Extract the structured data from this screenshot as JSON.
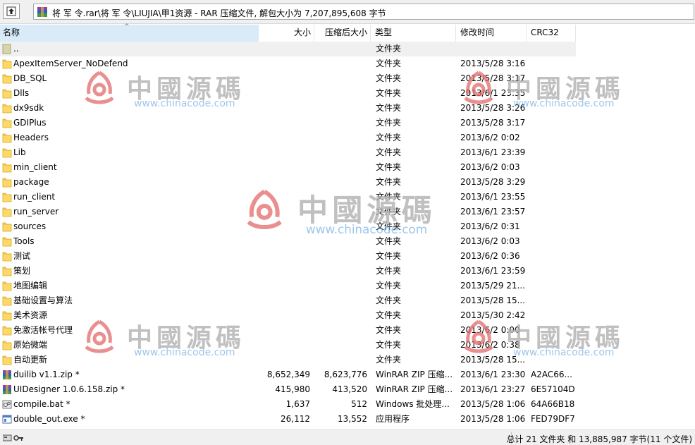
{
  "toolbar": {
    "path": "将 军 令.rar\\将 军 令\\LIUJIA\\甲1资源 - RAR 压缩文件, 解包大小为 7,207,895,608 字节"
  },
  "columns": {
    "name": "名称",
    "size": "大小",
    "packed": "压缩后大小",
    "type": "类型",
    "modified": "修改时间",
    "crc": "CRC32"
  },
  "rows": [
    {
      "name": "..",
      "size": "",
      "packed": "",
      "type": "文件夹",
      "modified": "",
      "crc": "",
      "icon": "parent-folder"
    },
    {
      "name": "ApexItemServer_NoDefend",
      "size": "",
      "packed": "",
      "type": "文件夹",
      "modified": "2013/5/28 3:16",
      "crc": "",
      "icon": "folder"
    },
    {
      "name": "DB_SQL",
      "size": "",
      "packed": "",
      "type": "文件夹",
      "modified": "2013/5/28 3:17",
      "crc": "",
      "icon": "folder"
    },
    {
      "name": "Dlls",
      "size": "",
      "packed": "",
      "type": "文件夹",
      "modified": "2013/6/1 23:35",
      "crc": "",
      "icon": "folder"
    },
    {
      "name": "dx9sdk",
      "size": "",
      "packed": "",
      "type": "文件夹",
      "modified": "2013/5/28 3:26",
      "crc": "",
      "icon": "folder"
    },
    {
      "name": "GDIPlus",
      "size": "",
      "packed": "",
      "type": "文件夹",
      "modified": "2013/5/28 3:17",
      "crc": "",
      "icon": "folder"
    },
    {
      "name": "Headers",
      "size": "",
      "packed": "",
      "type": "文件夹",
      "modified": "2013/6/2 0:02",
      "crc": "",
      "icon": "folder"
    },
    {
      "name": "Lib",
      "size": "",
      "packed": "",
      "type": "文件夹",
      "modified": "2013/6/1 23:39",
      "crc": "",
      "icon": "folder"
    },
    {
      "name": "min_client",
      "size": "",
      "packed": "",
      "type": "文件夹",
      "modified": "2013/6/2 0:03",
      "crc": "",
      "icon": "folder"
    },
    {
      "name": "package",
      "size": "",
      "packed": "",
      "type": "文件夹",
      "modified": "2013/5/28 3:29",
      "crc": "",
      "icon": "folder"
    },
    {
      "name": "run_client",
      "size": "",
      "packed": "",
      "type": "文件夹",
      "modified": "2013/6/1 23:55",
      "crc": "",
      "icon": "folder"
    },
    {
      "name": "run_server",
      "size": "",
      "packed": "",
      "type": "文件夹",
      "modified": "2013/6/1 23:57",
      "crc": "",
      "icon": "folder"
    },
    {
      "name": "sources",
      "size": "",
      "packed": "",
      "type": "文件夹",
      "modified": "2013/6/2 0:31",
      "crc": "",
      "icon": "folder"
    },
    {
      "name": "Tools",
      "size": "",
      "packed": "",
      "type": "文件夹",
      "modified": "2013/6/2 0:03",
      "crc": "",
      "icon": "folder"
    },
    {
      "name": "测试",
      "size": "",
      "packed": "",
      "type": "文件夹",
      "modified": "2013/6/2 0:36",
      "crc": "",
      "icon": "folder"
    },
    {
      "name": "策划",
      "size": "",
      "packed": "",
      "type": "文件夹",
      "modified": "2013/6/1 23:59",
      "crc": "",
      "icon": "folder"
    },
    {
      "name": "地图编辑",
      "size": "",
      "packed": "",
      "type": "文件夹",
      "modified": "2013/5/29 21...",
      "crc": "",
      "icon": "folder"
    },
    {
      "name": "基础设置与算法",
      "size": "",
      "packed": "",
      "type": "文件夹",
      "modified": "2013/5/28 15...",
      "crc": "",
      "icon": "folder"
    },
    {
      "name": "美术资源",
      "size": "",
      "packed": "",
      "type": "文件夹",
      "modified": "2013/5/30 2:42",
      "crc": "",
      "icon": "folder"
    },
    {
      "name": "免激活帐号代理",
      "size": "",
      "packed": "",
      "type": "文件夹",
      "modified": "2013/6/2 0:00",
      "crc": "",
      "icon": "folder"
    },
    {
      "name": "原始微端",
      "size": "",
      "packed": "",
      "type": "文件夹",
      "modified": "2013/6/2 0:38",
      "crc": "",
      "icon": "folder"
    },
    {
      "name": "自动更新",
      "size": "",
      "packed": "",
      "type": "文件夹",
      "modified": "2013/5/28 15...",
      "crc": "",
      "icon": "folder"
    },
    {
      "name": "duilib v1.1.zip *",
      "size": "8,652,349",
      "packed": "8,623,776",
      "type": "WinRAR ZIP 压缩...",
      "modified": "2013/6/1 23:30",
      "crc": "A2AC66...",
      "icon": "zip"
    },
    {
      "name": "UIDesigner 1.0.6.158.zip *",
      "size": "415,980",
      "packed": "413,520",
      "type": "WinRAR ZIP 压缩...",
      "modified": "2013/6/1 23:27",
      "crc": "6E57104D",
      "icon": "zip"
    },
    {
      "name": "compile.bat *",
      "size": "1,637",
      "packed": "512",
      "type": "Windows 批处理...",
      "modified": "2013/5/28 1:06",
      "crc": "64A66B18",
      "icon": "bat"
    },
    {
      "name": "double_out.exe *",
      "size": "26,112",
      "packed": "13,552",
      "type": "应用程序",
      "modified": "2013/5/28 1:06",
      "crc": "FED79DF7",
      "icon": "exe"
    }
  ],
  "status": {
    "text": "总计 21 文件夹 和 13,885,987 字节(11 个文件)"
  },
  "watermark": {
    "cn": "中國源碼",
    "url": "www.chinacode.com"
  },
  "colors": {
    "folder": "#f3c94f",
    "sort_highlight": "#d9ebf9",
    "watermark_logo": "#e36a6a"
  }
}
